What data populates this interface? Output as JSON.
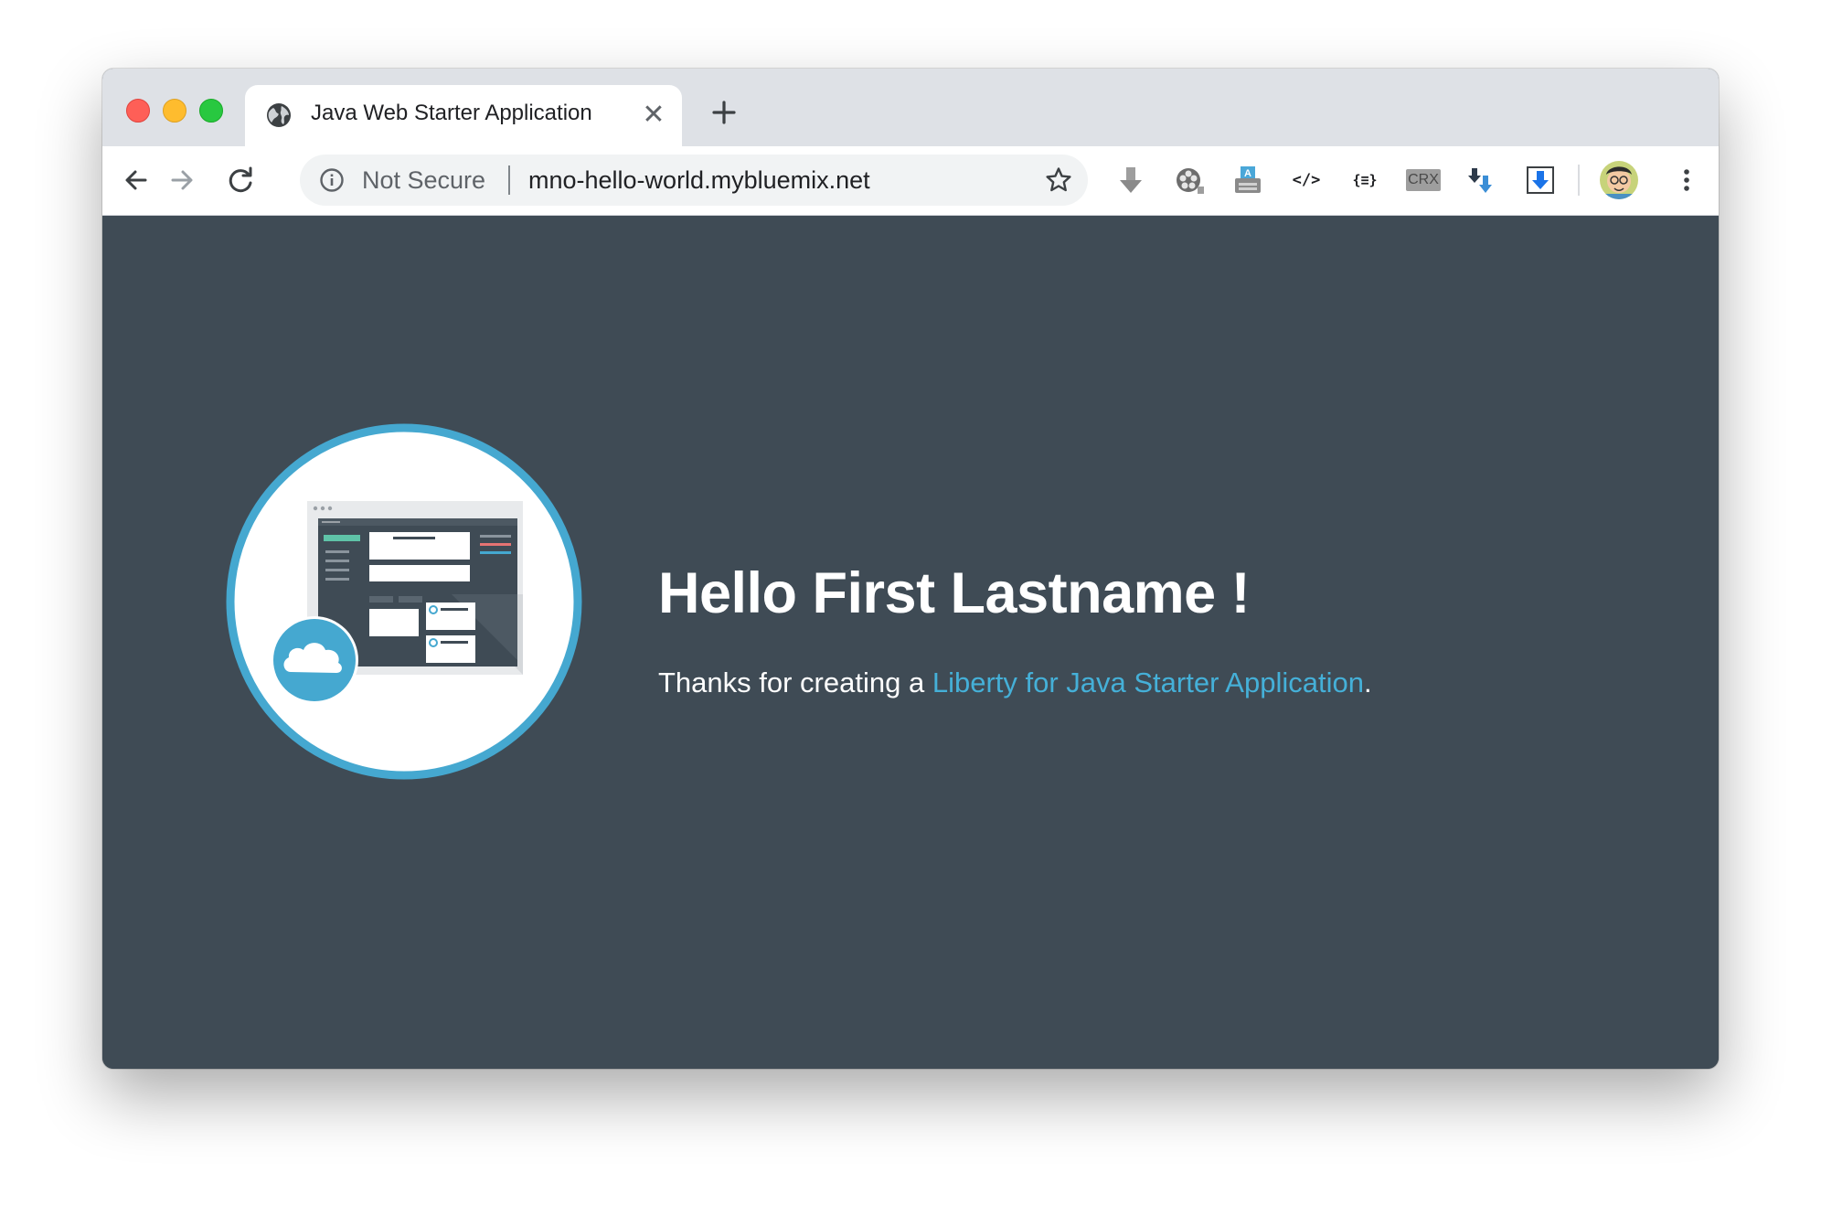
{
  "window": {
    "traffic_lights": [
      "close",
      "minimize",
      "zoom"
    ]
  },
  "tab": {
    "title": "Java Web Starter Application",
    "icon": "globe-icon",
    "close_glyph": "✕"
  },
  "toolbar": {
    "security_label": "Not Secure",
    "url": "mno-hello-world.mybluemix.net",
    "extensions": [
      {
        "name": "download-arrow-icon"
      },
      {
        "name": "film-reel-icon"
      },
      {
        "name": "typewriter-icon"
      },
      {
        "name": "code-icon",
        "text": "</>"
      },
      {
        "name": "json-formatter-icon",
        "text": "{≡}"
      },
      {
        "name": "crx-icon",
        "text": "CRX"
      },
      {
        "name": "sort-download-icon"
      },
      {
        "name": "download-box-icon"
      }
    ]
  },
  "page": {
    "greeting": "Hello First Lastname !",
    "thanks_prefix": "Thanks for creating a ",
    "thanks_link": "Liberty for Java Starter Application",
    "thanks_suffix": ".",
    "colors": {
      "background": "#3f4b55",
      "link": "#45b0d8",
      "accent_ring": "#45a8d0"
    }
  }
}
